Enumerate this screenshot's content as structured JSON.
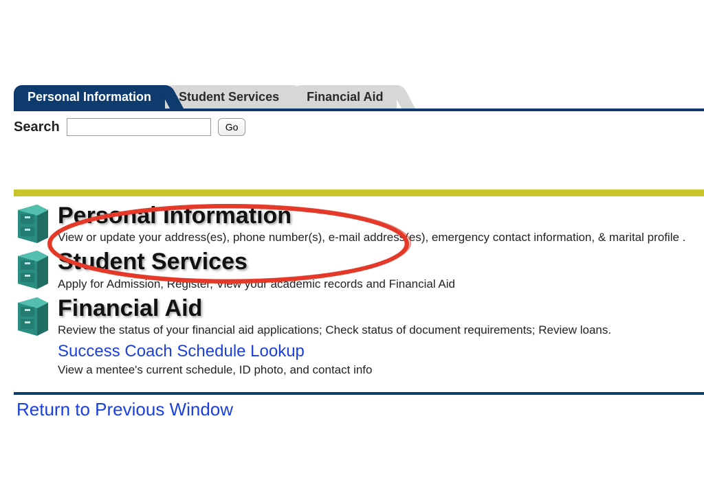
{
  "tabs": {
    "personal": "Personal Information",
    "student": "Student Services",
    "finaid": "Financial Aid"
  },
  "search": {
    "label": "Search",
    "go": "Go",
    "value": ""
  },
  "menu": {
    "personal": {
      "title": "Personal Information",
      "desc": "View or update your address(es), phone number(s), e-mail address(es), emergency contact information, & marital profile ."
    },
    "student": {
      "title": "Student Services",
      "desc": "Apply for Admission, Register, View your academic records and Financial Aid"
    },
    "finaid": {
      "title": "Financial Aid",
      "desc": "Review the status of your financial aid applications; Check status of document requirements; Review loans."
    },
    "coach": {
      "title": "Success Coach Schedule Lookup",
      "desc": "View a mentee's current schedule, ID photo, and contact info"
    }
  },
  "return_link": "Return to Previous Window"
}
